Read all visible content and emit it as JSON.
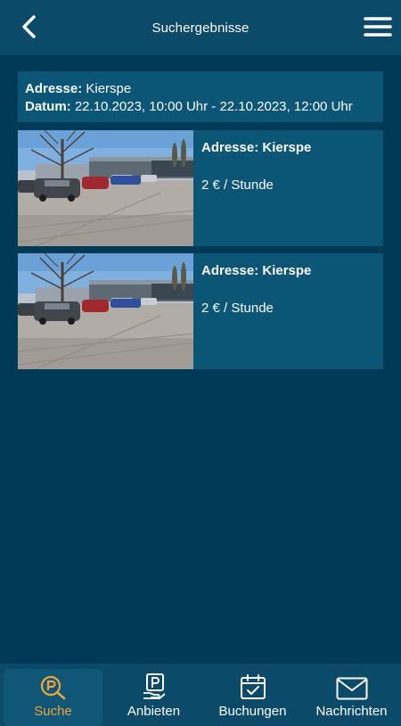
{
  "header": {
    "title": "Suchergebnisse",
    "back_icon": "chevron-left-icon",
    "menu_icon": "hamburger-menu-icon"
  },
  "search": {
    "address_label": "Adresse:",
    "address_value": "Kierspe",
    "date_label": "Datum:",
    "date_value": "22.10.2023, 10:00 Uhr - 22.10.2023, 12:00 Uhr"
  },
  "results": [
    {
      "address": "Adresse: Kierspe",
      "price": "2 € / Stunde",
      "image": "parking-lot-photo"
    },
    {
      "address": "Adresse: Kierspe",
      "price": "2 € / Stunde",
      "image": "parking-lot-photo"
    }
  ],
  "nav": {
    "items": [
      {
        "label": "Suche",
        "icon": "parking-search-icon",
        "active": true
      },
      {
        "label": "Anbieten",
        "icon": "parking-offer-icon",
        "active": false
      },
      {
        "label": "Buchungen",
        "icon": "calendar-check-icon",
        "active": false
      },
      {
        "label": "Nachrichten",
        "icon": "envelope-icon",
        "active": false
      }
    ]
  },
  "colors": {
    "background": "#003a57",
    "header": "#0b4b69",
    "card": "#0b5577",
    "accent": "#f2a53b"
  }
}
